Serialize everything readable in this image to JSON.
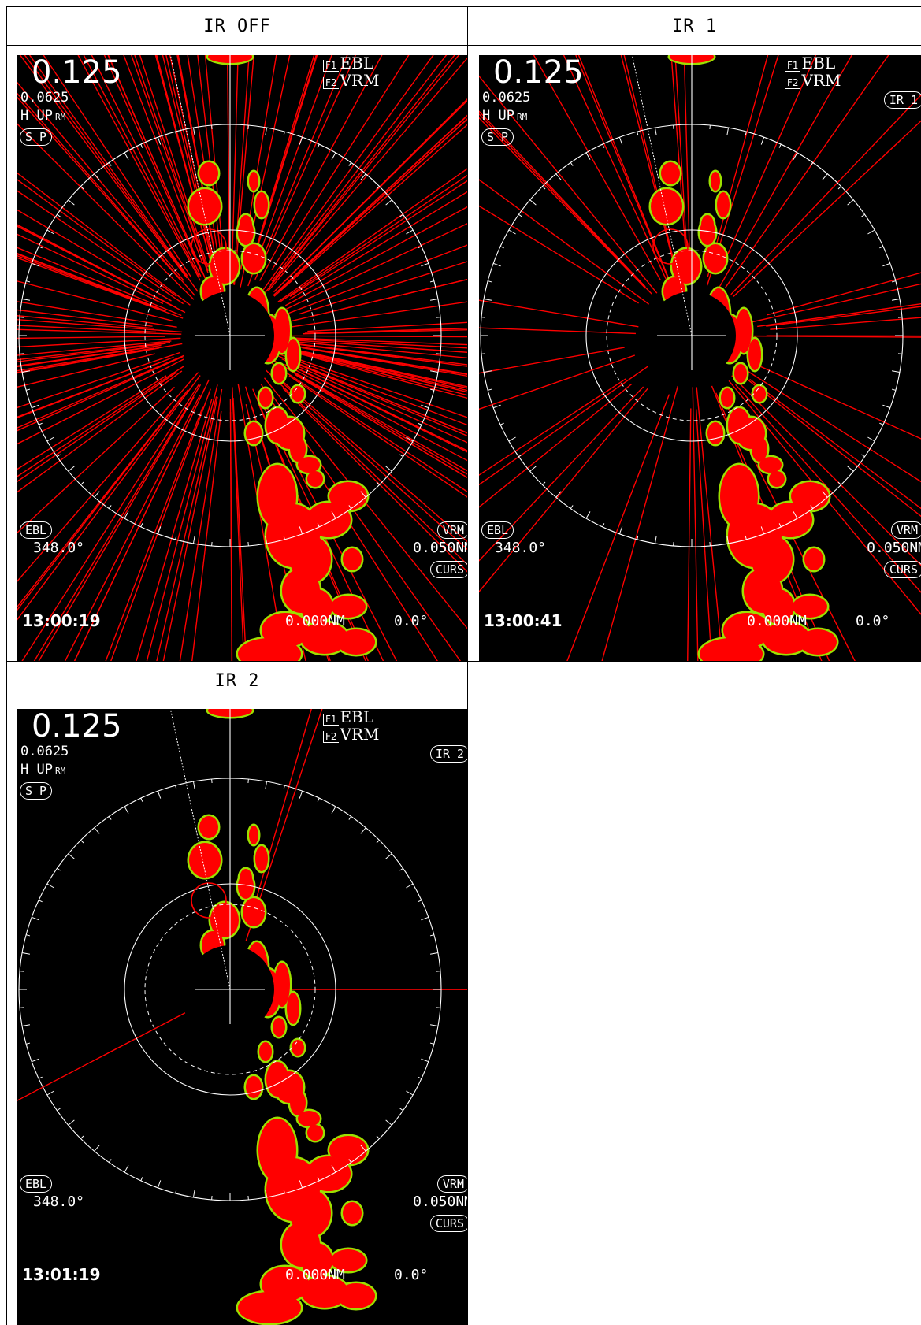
{
  "panels": [
    {
      "id": "ir-off",
      "header": "IR OFF",
      "range": "0.125",
      "ring": "0.0625",
      "mode": "H UP",
      "mode_sub": "RM",
      "sp": "S P",
      "f1_key": "F1",
      "f1_label": "EBL",
      "f2_key": "F2",
      "f2_label": "VRM",
      "ir_badge": "",
      "ebl_label": "EBL",
      "ebl_value": "348.0°",
      "vrm_label": "VRM",
      "vrm_value": "0.050NM",
      "curs_label": "CURS",
      "cursor_range": "0.000NM",
      "cursor_bearing": "0.0°",
      "time": "13:00:19",
      "interference_level": 1.0
    },
    {
      "id": "ir-1",
      "header": "IR 1",
      "range": "0.125",
      "ring": "0.0625",
      "mode": "H UP",
      "mode_sub": "RM",
      "sp": "S P",
      "f1_key": "F1",
      "f1_label": "EBL",
      "f2_key": "F2",
      "f2_label": "VRM",
      "ir_badge": "IR 1",
      "ebl_label": "EBL",
      "ebl_value": "348.0°",
      "vrm_label": "VRM",
      "vrm_value": "0.050NM",
      "curs_label": "CURS",
      "cursor_range": "0.000NM",
      "cursor_bearing": "0.0°",
      "time": "13:00:41",
      "interference_level": 0.3
    },
    {
      "id": "ir-2",
      "header": "IR 2",
      "range": "0.125",
      "ring": "0.0625",
      "mode": "H UP",
      "mode_sub": "RM",
      "sp": "S P",
      "f1_key": "F1",
      "f1_label": "EBL",
      "f2_key": "F2",
      "f2_label": "VRM",
      "ir_badge": "IR 2",
      "ebl_label": "EBL",
      "ebl_value": "348.0°",
      "vrm_label": "VRM",
      "vrm_value": "0.050NM",
      "curs_label": "CURS",
      "cursor_range": "0.000NM",
      "cursor_bearing": "0.0°",
      "time": "13:01:19",
      "interference_level": 0.02
    }
  ],
  "colors": {
    "echo": "#ff0000",
    "echo_edge": "#9ce000",
    "ring": "#ffffff",
    "background": "#000000"
  }
}
